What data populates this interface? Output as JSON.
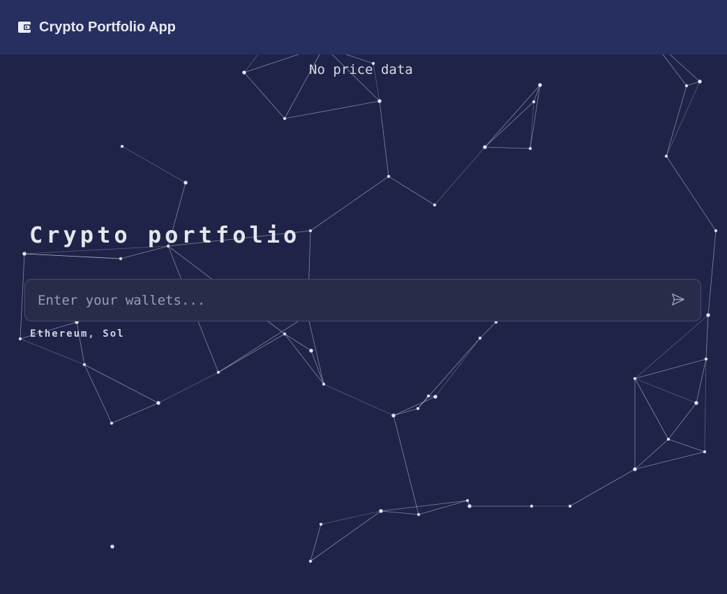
{
  "header": {
    "app_icon": "wallet-icon",
    "title": "Crypto Portfolio App"
  },
  "price_status": "No price data",
  "main": {
    "heading": "Crypto portfolio",
    "wallet_input": {
      "placeholder": "Enter your wallets...",
      "value": ""
    },
    "send_icon": "send-icon",
    "chains_hint": "Ethereum, Sol"
  },
  "colors": {
    "background": "#1e2347",
    "header_background": "#262f60",
    "input_background": "#292c49",
    "text": "#e5e6ee"
  }
}
